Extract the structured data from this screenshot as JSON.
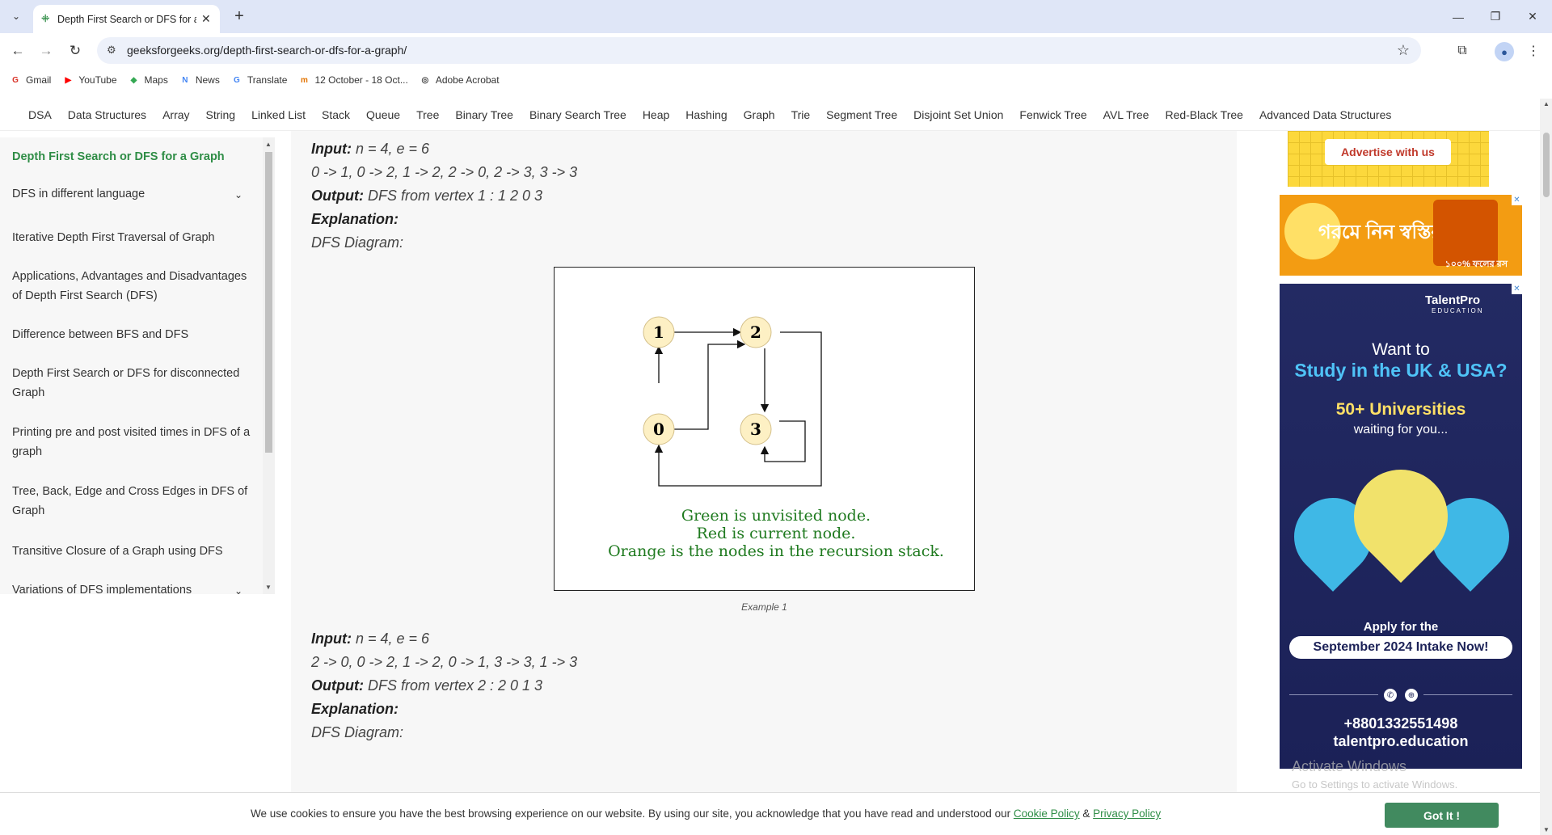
{
  "browser": {
    "tab_title": "Depth First Search or DFS for a Graph",
    "tab_favicon": "gfg-favicon",
    "url": "geeksforgeeks.org/depth-first-search-or-dfs-for-a-graph/",
    "bookmarks": [
      {
        "label": "Gmail",
        "icon": "gmail-icon",
        "color": "#d93025",
        "glyph": "G"
      },
      {
        "label": "YouTube",
        "icon": "youtube-icon",
        "color": "#ff0000",
        "glyph": "▶"
      },
      {
        "label": "Maps",
        "icon": "maps-icon",
        "color": "#34a853",
        "glyph": "◆"
      },
      {
        "label": "News",
        "icon": "news-icon",
        "color": "#4285f4",
        "glyph": "N"
      },
      {
        "label": "Translate",
        "icon": "translate-icon",
        "color": "#4285f4",
        "glyph": "G"
      },
      {
        "label": "12 October - 18 Oct...",
        "icon": "calendar-icon",
        "color": "#e37400",
        "glyph": "m"
      },
      {
        "label": "Adobe Acrobat",
        "icon": "acrobat-icon",
        "color": "#444444",
        "glyph": "◎"
      }
    ]
  },
  "site_nav": [
    "DSA",
    "Data Structures",
    "Array",
    "String",
    "Linked List",
    "Stack",
    "Queue",
    "Tree",
    "Binary Tree",
    "Binary Search Tree",
    "Heap",
    "Hashing",
    "Graph",
    "Trie",
    "Segment Tree",
    "Disjoint Set Union",
    "Fenwick Tree",
    "AVL Tree",
    "Red-Black Tree",
    "Advanced Data Structures"
  ],
  "sidebar": {
    "active": "Depth First Search or DFS for a Graph",
    "items": [
      "DFS in different language",
      "Iterative Depth First Traversal of Graph",
      "Applications, Advantages and Disadvantages of Depth First Search (DFS)",
      "Difference between BFS and DFS",
      "Depth First Search or DFS for disconnected Graph",
      "Printing pre and post visited times in DFS of a graph",
      "Tree, Back, Edge and Cross Edges in DFS of Graph",
      "Transitive Closure of a Graph using DFS",
      "Variations of DFS implementations"
    ]
  },
  "example1": {
    "input_label": "Input:",
    "input_value": " n = 4, e = 6",
    "edges": "0 -> 1, 0 -> 2, 1 -> 2, 2 -> 0, 2 -> 3, 3 -> 3",
    "output_label": "Output:",
    "output_value": " DFS from vertex 1 : 1 2 0 3",
    "explanation_label": "Explanation:",
    "diagram_label": "DFS Diagram:",
    "caption": "Example 1"
  },
  "diagram": {
    "nodes": [
      "1",
      "2",
      "0",
      "3"
    ],
    "node_fill": "#fdf0c4",
    "legend": [
      "Green is unvisited node.",
      "Red is current node.",
      "Orange is the nodes in the recursion stack."
    ],
    "legend_color": "#1f7a1f"
  },
  "example2": {
    "input_label": "Input:",
    "input_value": " n = 4, e = 6",
    "edges": "2 -> 0, 0 -> 2, 1 -> 2, 0 -> 1, 3 -> 3, 1 -> 3",
    "output_label": "Output:",
    "output_value": " DFS from vertex 2 : 2 0 1 3",
    "explanation_label": "Explanation:",
    "diagram_label": "DFS Diagram:"
  },
  "ads": {
    "advertise_button": "Advertise with us",
    "bengali_headline": "গরমে নিন স্বস্তির",
    "bengali_sub": "১০০% ফলের রস",
    "talentpro": {
      "logo": "TalentPro",
      "logo_sub": "EDUCATION",
      "want_to": "Want to",
      "study": "Study in the UK & USA?",
      "universities": "50+ Universities",
      "waiting": "waiting for you...",
      "apply": "Apply for the",
      "intake": "September 2024 Intake Now!",
      "phone": "+8801332551498",
      "website": "talentpro.education"
    }
  },
  "watermark": {
    "line1": "Activate Windows",
    "line2": "Go to Settings to activate Windows."
  },
  "cookie": {
    "message": "We use cookies to ensure you have the best browsing experience on our website. By using our site, you acknowledge that you have read and understood our ",
    "cookie_policy": "Cookie Policy",
    "amp": " & ",
    "privacy_policy": "Privacy Policy",
    "button": "Got It !"
  },
  "colors": {
    "gfg_green": "#2f8d46",
    "tab_bar": "#dfe6f7",
    "cookie_button": "#418a5f"
  }
}
